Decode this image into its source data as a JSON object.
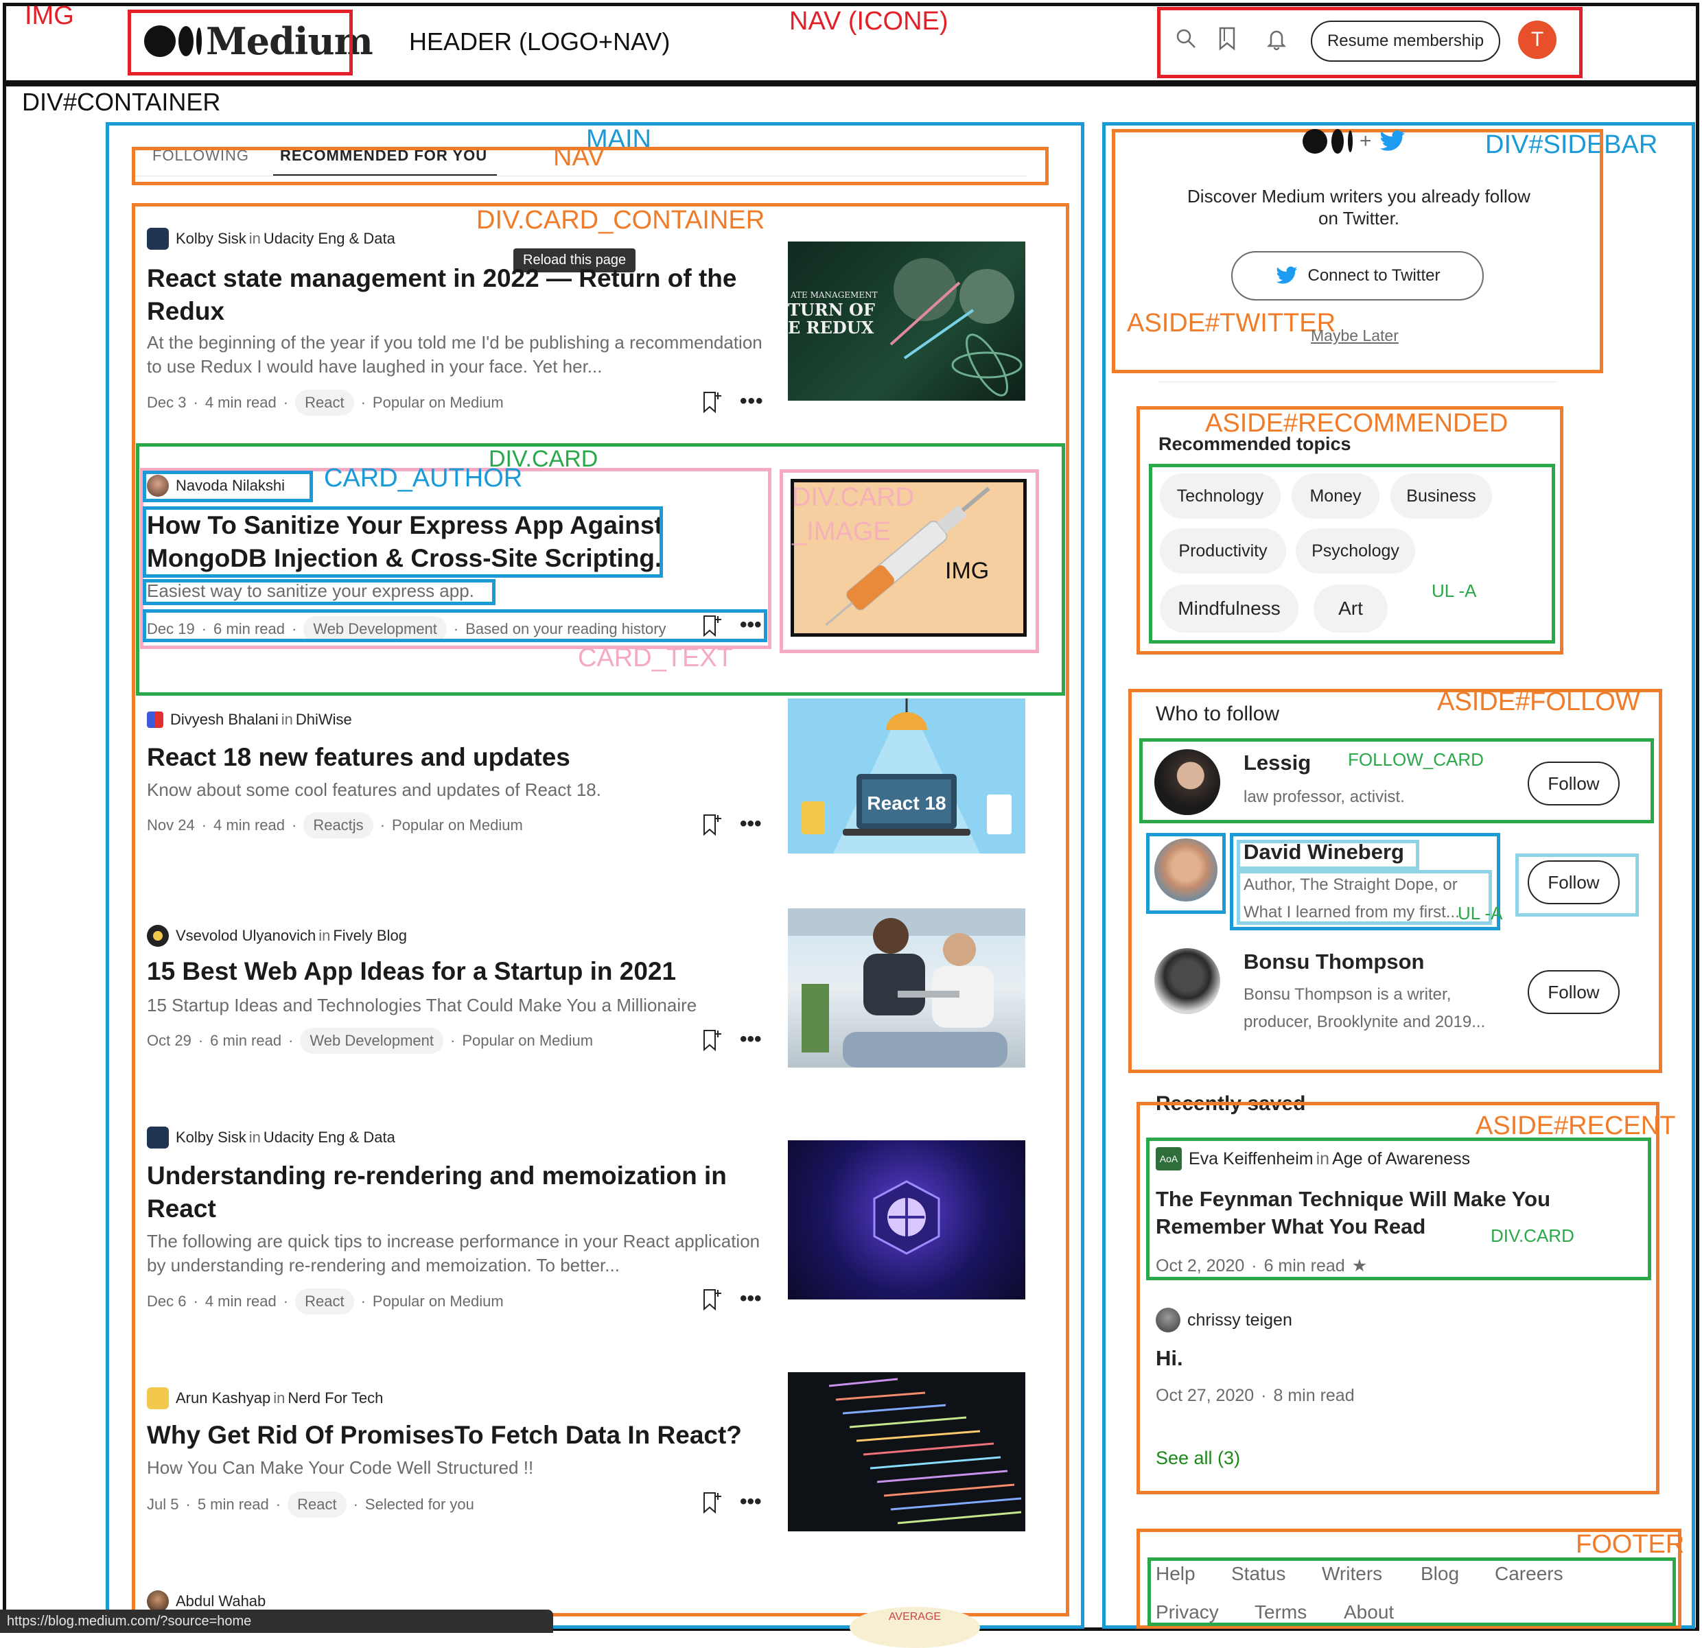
{
  "annotations": {
    "img": "IMG",
    "header": "HEADER (LOGO+NAV)",
    "nav_icons": "NAV (ICONE)",
    "container": "DIV#CONTAINER",
    "main": "MAIN",
    "main_nav": "NAV",
    "card_container": "DIV.CARD_CONTAINER",
    "div_card": "DIV.CARD",
    "card_author": "CARD_AUTHOR",
    "card_image": "DIV.CARD _IMAGE",
    "card_text": "CARD_TEXT",
    "img_placeholder": "IMG",
    "sidebar": "DIV#SIDEBAR",
    "aside_twitter": "ASIDE#TWITTER",
    "aside_recommended": "ASIDE#RECOMMENDED",
    "ul_a_topics": "UL -A",
    "aside_follow": "ASIDE#FOLLOW",
    "follow_card": "FOLLOW_CARD",
    "ul_a_follow": "UL -A",
    "aside_recent": "ASIDE#RECENT",
    "recent_div_card": "DIV.CARD",
    "footer": "FOOTER"
  },
  "header": {
    "logo_text": "Medium",
    "icons": [
      "search-icon",
      "bookmark-icon",
      "bell-icon"
    ],
    "resume_label": "Resume membership",
    "avatar_letter": "T"
  },
  "tabs": {
    "following": "FOLLOWING",
    "recommended": "RECOMMENDED FOR YOU"
  },
  "tooltip": "Reload this page",
  "articles": [
    {
      "author": "Kolby Sisk",
      "in": "in",
      "publication": "Udacity Eng & Data",
      "title": "React state management in 2022 — Return of the Redux",
      "subtitle": "At the beginning of the year if you told me I'd be publishing a recommendation to use Redux I would have laughed in your face. Yet her...",
      "date": "Dec 3",
      "read": "4 min read",
      "tag": "React",
      "reason": "Popular on Medium",
      "thumb_text": "ATE MANAGEMENT\nTURN OF\nE REDUX\nSODE (LOST COUNT)"
    },
    {
      "author": "Navoda Nilakshi",
      "in": "",
      "publication": "",
      "title": "How To Sanitize Your Express App Against MongoDB Injection & Cross-Site Scripting.",
      "subtitle": "Easiest way to sanitize your express app.",
      "date": "Dec 19",
      "read": "6 min read",
      "tag": "Web Development",
      "reason": "Based on your reading history"
    },
    {
      "author": "Divyesh Bhalani",
      "in": "in",
      "publication": "DhiWise",
      "title": "React 18 new features and updates",
      "subtitle": "Know about some cool features and updates of React 18.",
      "date": "Nov 24",
      "read": "4 min read",
      "tag": "Reactjs",
      "reason": "Popular on Medium",
      "thumb_text": "React 18"
    },
    {
      "author": "Vsevolod Ulyanovich",
      "in": "in",
      "publication": "Fively Blog",
      "title": "15 Best Web App Ideas for a Startup in 2021",
      "subtitle": "15 Startup Ideas and Technologies That Could Make You a Millionaire",
      "date": "Oct 29",
      "read": "6 min read",
      "tag": "Web Development",
      "reason": "Popular on Medium"
    },
    {
      "author": "Kolby Sisk",
      "in": "in",
      "publication": "Udacity Eng & Data",
      "title": "Understanding re-rendering and memoization in React",
      "subtitle": "The following are quick tips to increase performance in your React application by understanding re-rendering and memoization. To better...",
      "date": "Dec 6",
      "read": "4 min read",
      "tag": "React",
      "reason": "Popular on Medium"
    },
    {
      "author": "Arun Kashyap",
      "in": "in",
      "publication": "Nerd For Tech",
      "title": "Why Get Rid Of PromisesTo Fetch Data In React?",
      "subtitle": "How You Can Make Your Code Well Structured !!",
      "date": "Jul 5",
      "read": "5 min read",
      "tag": "React",
      "reason": "Selected for you"
    }
  ],
  "next_author": "Abdul Wahab",
  "status_url": "https://blog.medium.com/?source=home",
  "average_text": "AVERAGE",
  "twitter": {
    "text": "Discover Medium writers you already follow on Twitter.",
    "connect_label": "Connect to Twitter",
    "later_label": "Maybe Later"
  },
  "recommended": {
    "title": "Recommended topics",
    "topics": [
      "Technology",
      "Money",
      "Business",
      "Productivity",
      "Psychology",
      "Mindfulness",
      "Art"
    ]
  },
  "follow": {
    "title": "Who to follow",
    "people": [
      {
        "name": "Lessig",
        "bio": "law professor, activist.",
        "button": "Follow"
      },
      {
        "name": "David Wineberg",
        "bio": "Author, The Straight Dope, or What I learned from my first...",
        "button": "Follow"
      },
      {
        "name": "Bonsu Thompson",
        "bio": "Bonsu Thompson is a writer, producer, Brooklynite and 2019...",
        "button": "Follow"
      }
    ]
  },
  "recent": {
    "title": "Recently saved",
    "items": [
      {
        "author": "Eva Keiffenheim",
        "in": "in",
        "publication": "Age of Awareness",
        "badge": "AoA",
        "title": "The Feynman Technique Will Make You Remember What You Read",
        "date": "Oct 2, 2020",
        "read": "6 min read",
        "star": "★"
      },
      {
        "author": "chrissy teigen",
        "title": "Hi.",
        "date": "Oct 27, 2020",
        "read": "8 min read"
      }
    ],
    "see_all": "See all (3)"
  },
  "footer": {
    "links": [
      "Help",
      "Status",
      "Writers",
      "Blog",
      "Careers",
      "Privacy",
      "Terms",
      "About"
    ]
  }
}
